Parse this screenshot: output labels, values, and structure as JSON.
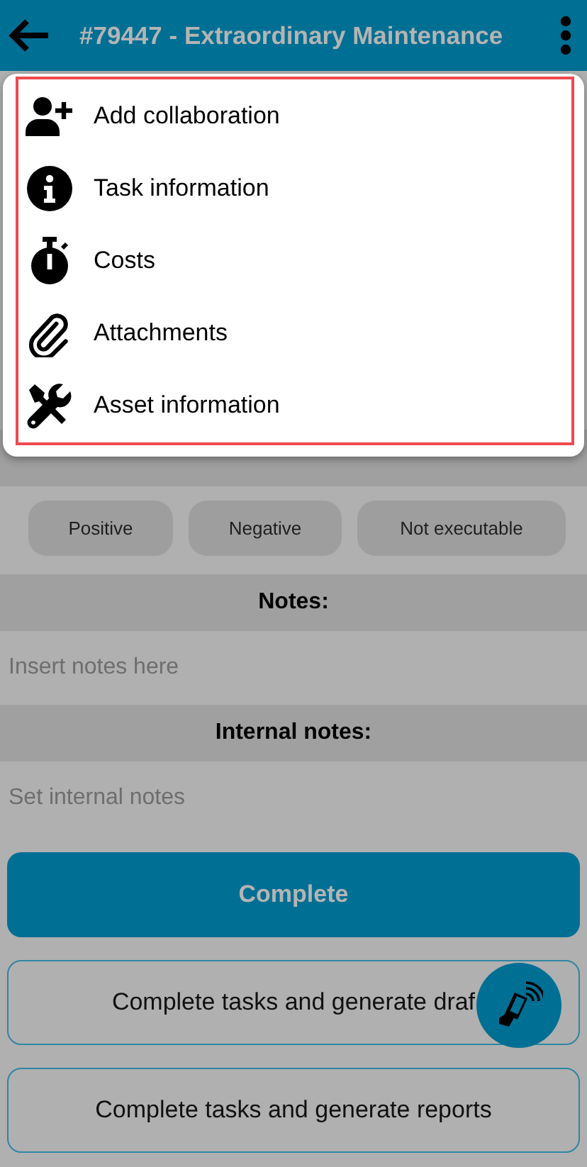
{
  "header": {
    "title": "#79447 - Extraordinary Maintenance"
  },
  "menu": {
    "items": [
      {
        "kind": "person-plus",
        "label": "Add collaboration"
      },
      {
        "kind": "info",
        "label": "Task information"
      },
      {
        "kind": "stopwatch",
        "label": "Costs"
      },
      {
        "kind": "paperclip",
        "label": "Attachments"
      },
      {
        "kind": "tools",
        "label": "Asset information"
      }
    ]
  },
  "result": {
    "options": [
      "Positive",
      "Negative",
      "Not executable"
    ]
  },
  "notes": {
    "title": "Notes:",
    "placeholder": "Insert notes here"
  },
  "internal_notes": {
    "title": "Internal notes:",
    "placeholder": "Set internal notes"
  },
  "actions": [
    {
      "kind": "primary",
      "label": "Complete"
    },
    {
      "kind": "outline",
      "label": "Complete tasks and generate draf"
    },
    {
      "kind": "outline",
      "label": "Complete tasks and generate reports"
    }
  ]
}
